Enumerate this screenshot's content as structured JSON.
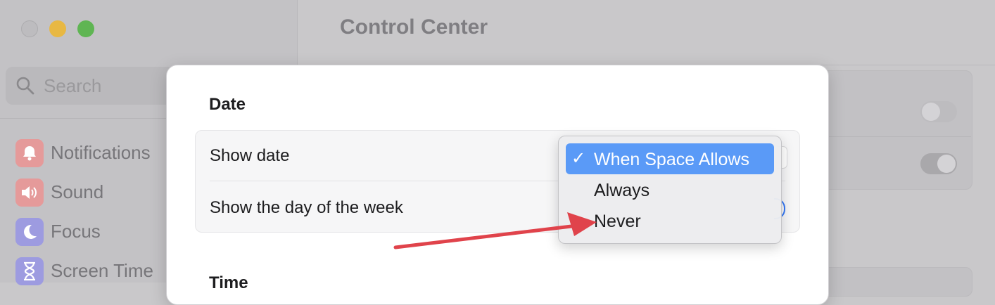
{
  "window": {
    "title": "Control Center"
  },
  "sidebar": {
    "search": {
      "placeholder": "Search"
    },
    "items": [
      {
        "label": "Notifications",
        "icon": "bell-icon",
        "color": "#e59a9a"
      },
      {
        "label": "Sound",
        "icon": "speaker-icon",
        "color": "#e59a9a"
      },
      {
        "label": "Focus",
        "icon": "moon-icon",
        "color": "#9d9be0"
      },
      {
        "label": "Screen Time",
        "icon": "hourglass-icon",
        "color": "#9d9be0"
      }
    ]
  },
  "background_toggles": [
    {
      "state": "off"
    },
    {
      "state": "on"
    }
  ],
  "sheet": {
    "date_section": {
      "title": "Date",
      "rows": [
        {
          "label": "Show date",
          "control": "popup",
          "value": "When Space Allows"
        },
        {
          "label": "Show the day of the week",
          "control": "toggle",
          "value": "on"
        }
      ]
    },
    "time_section": {
      "title": "Time"
    }
  },
  "dropdown": {
    "options": [
      {
        "label": "When Space Allows",
        "selected": true
      },
      {
        "label": "Always",
        "selected": false
      },
      {
        "label": "Never",
        "selected": false
      }
    ],
    "check_glyph": "✓"
  },
  "annotation": {
    "arrow_color": "#e0434b",
    "target": "Never"
  },
  "colors": {
    "accent": "#3478f6",
    "menu_highlight": "#5a9af7",
    "traffic_min": "#e8b843",
    "traffic_max": "#5fb553"
  }
}
